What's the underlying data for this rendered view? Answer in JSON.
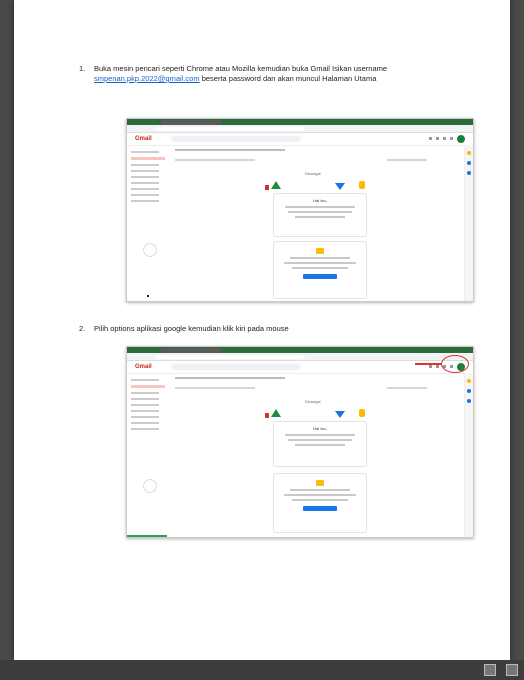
{
  "document": {
    "step1": {
      "number": "1.",
      "text_before_link": "Buka mesin pencari seperti Chrome atau Mozilla kemudian buka Gmail Isikan username",
      "link": "smpenan.pkp.2022@gmail.com",
      "text_after_link": "beserta password dan akan muncul Halaman Utama"
    },
    "step2": {
      "number": "2.",
      "text": "Pilih options aplikasi google kemudian klik kiri pada mouse"
    },
    "screenshot": {
      "app": "Gmail",
      "card_header": "Dicurigai",
      "card_title": "Hai Isu,"
    }
  },
  "viewer": {
    "bottom_icons": [
      "page-icon",
      "page-icon"
    ]
  }
}
